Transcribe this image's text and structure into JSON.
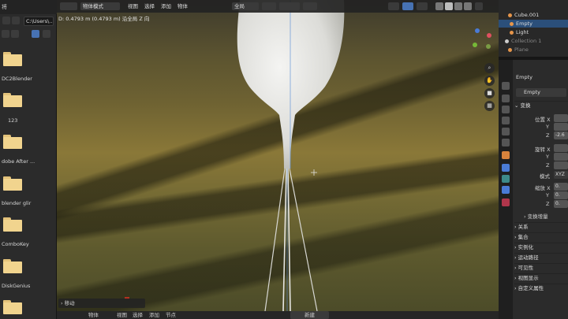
{
  "filebrowser": {
    "title": "将",
    "path": "C:\\Users\\...",
    "folders": [
      {
        "label": ""
      },
      {
        "label": "DC2Blender"
      },
      {
        "label": "123"
      },
      {
        "label": "dobe After ..."
      },
      {
        "label": "blender glir"
      },
      {
        "label": "ComboKey"
      },
      {
        "label": "DiskGenius"
      },
      {
        "label": ""
      }
    ]
  },
  "viewport": {
    "mode": "物体模式",
    "menus": [
      "视图",
      "选择",
      "添加",
      "物体"
    ],
    "transform_orientation": "全局",
    "status": "D: 0.4793 m (0.4793 m) 沿全局 Z 向",
    "operator_panel": "移动",
    "bottom_mode": "物体",
    "bottom_menus": [
      "视图",
      "选择",
      "添加",
      "节点"
    ],
    "bottom_field": "新建"
  },
  "outliner": {
    "items": [
      {
        "label": "Cube.001",
        "color": "#e6954a"
      },
      {
        "label": "Empty",
        "color": "#e6954a"
      },
      {
        "label": "Light",
        "color": "#e6954a"
      },
      {
        "label": "Collection 1",
        "color": "#cccccc"
      },
      {
        "label": "Plane",
        "color": "#e6954a"
      }
    ],
    "selected_index": 1
  },
  "properties": {
    "object_name": "Empty",
    "object_field": "Empty",
    "transform_header": "变换",
    "location_label": "位置 X",
    "rotation_label": "旋转 X",
    "scale_label": "缩放 X",
    "axis_y": "Y",
    "axis_z": "Z",
    "mode_label": "模式",
    "mode_value": "XYZ",
    "location_z": "-2.6",
    "scale_y": "0.",
    "scale_z": "0.",
    "scale_x": "0.",
    "delta_transform": "变换增量",
    "sections": [
      "关系",
      "集合",
      "实例化",
      "运动路径",
      "可见性",
      "视图显示",
      "自定义属性"
    ]
  },
  "colors": {
    "selection": "#2b4f7a",
    "accent_blue": "#4772b3",
    "folder": "#f1d48e"
  }
}
